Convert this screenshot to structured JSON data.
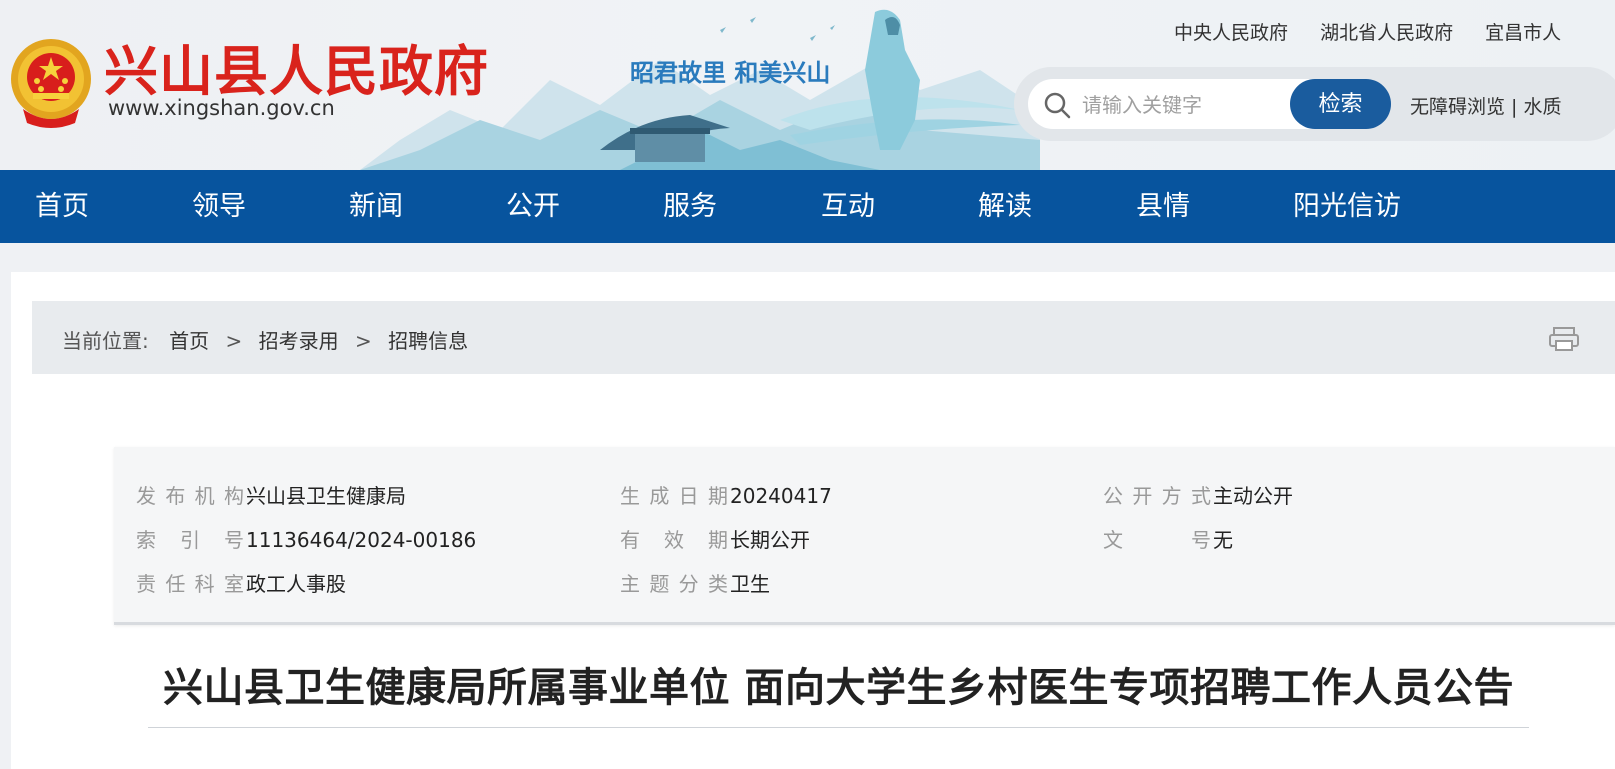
{
  "header": {
    "site_title": "兴山县人民政府",
    "site_url": "www.xingshan.gov.cn",
    "slogan": "昭君故里  和美兴山",
    "top_links": [
      "中央人民政府",
      "湖北省人民政府",
      "宜昌市人"
    ],
    "search": {
      "placeholder": "请输入关键字",
      "button_label": "检索"
    },
    "access_links": "无障碍浏览 | 水质"
  },
  "nav": {
    "items": [
      "首页",
      "领导",
      "新闻",
      "公开",
      "服务",
      "互动",
      "解读",
      "县情",
      "阳光信访"
    ]
  },
  "breadcrumb": {
    "label": "当前位置:",
    "items": [
      "首页",
      "招考录用",
      "招聘信息"
    ],
    "separator": ">"
  },
  "meta": {
    "publisher_key": "发布机构",
    "publisher_val": "兴山县卫生健康局",
    "date_key": "生成日期",
    "date_val": "20240417",
    "mode_key": "公开方式",
    "mode_val": "主动公开",
    "index_key": "索引号",
    "index_val": "11136464/2024-00186",
    "validity_key": "有效期",
    "validity_val": "长期公开",
    "docno_key": "文号",
    "docno_val": "无",
    "dept_key": "责任科室",
    "dept_val": "政工人事股",
    "topic_key": "主题分类",
    "topic_val": "卫生"
  },
  "article": {
    "title": "兴山县卫生健康局所属事业单位 面向大学生乡村医生专项招聘工作人员公告"
  },
  "colors": {
    "nav_bg": "#07549e",
    "title_red": "#d9231c",
    "search_btn": "#1a5c9e"
  },
  "icons": [
    "national-emblem-icon",
    "search-icon",
    "print-icon"
  ]
}
